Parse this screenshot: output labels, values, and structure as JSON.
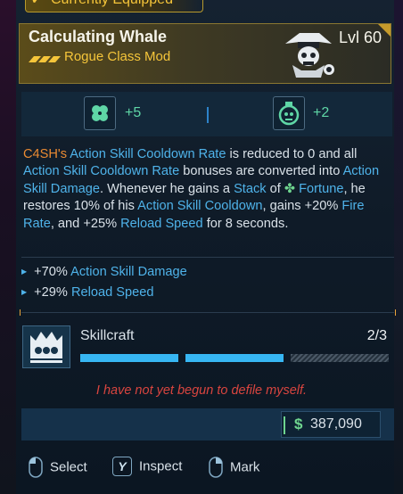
{
  "equipped_tab": {
    "label": "Currently Equipped"
  },
  "header": {
    "name": "Calculating Whale",
    "type": "Rogue Class Mod",
    "level": "Lvl 60"
  },
  "stats": [
    {
      "icon": "clover-icon",
      "value": "+5"
    },
    {
      "icon": "grenade-skull-icon",
      "value": "+2"
    }
  ],
  "description": {
    "p1": "C4SH's",
    "p2": " ",
    "p3": "Action Skill Cooldown Rate",
    "p4": " is reduced to 0 and all ",
    "p5": "Action Skill Cooldown Rate",
    "p6": " bonuses are converted into ",
    "p7": "Action Skill Damage",
    "p8": ". Whenever he gains a ",
    "p9": "Stack",
    "p10": " of ",
    "p11": "Fortune",
    "p12": ", he restores 10% of his ",
    "p13": "Action Skill Cooldown",
    "p14": ", gains +20% ",
    "p15": "Fire Rate",
    "p16": ", and +25% ",
    "p17": "Reload Speed",
    "p18": " for 8 seconds."
  },
  "bonuses": [
    {
      "value": "+70%",
      "stat": "Action Skill Damage"
    },
    {
      "value": "+29%",
      "stat": "Reload Speed"
    }
  ],
  "skill": {
    "name": "Skillcraft",
    "count": "2/3",
    "level": 2,
    "max": 3
  },
  "flavor_text": "I have not yet begun to defile myself.",
  "price": {
    "currency": "$",
    "amount": "387,090"
  },
  "controls": [
    {
      "icon": "mouse-left-icon",
      "label": "Select"
    },
    {
      "icon": "y-key-icon",
      "key": "Y",
      "label": "Inspect"
    },
    {
      "icon": "mouse-right-icon",
      "label": "Mark"
    }
  ],
  "colors": {
    "rarity_gold": "#f5c53a",
    "skill_blue": "#4fb3ea",
    "keyword_orange": "#e98a32",
    "fortune_green": "#6fd58f",
    "flavor_red": "#d9453f"
  }
}
